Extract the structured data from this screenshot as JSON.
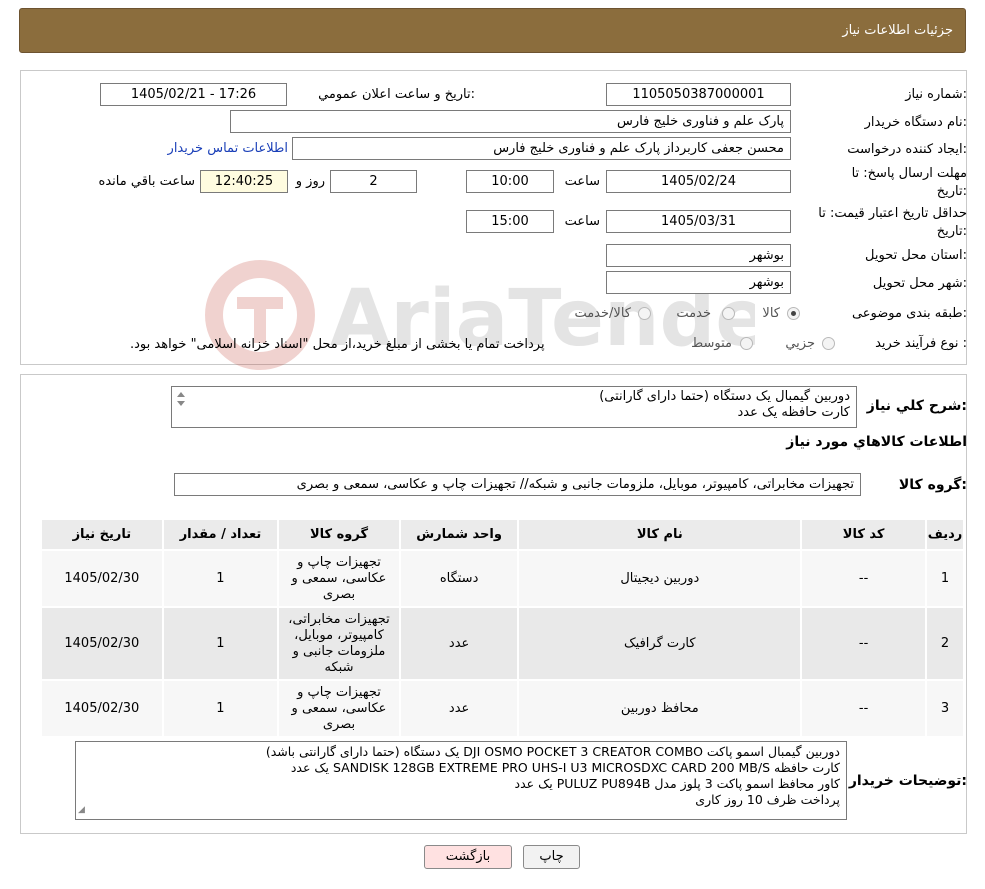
{
  "header": {
    "title": "جزئيات اطلاعات نياز"
  },
  "form": {
    "need_number_label": "شماره نياز:",
    "need_number": "1105050387000001",
    "announce_label": "تاريخ و ساعت اعلان عمومي:",
    "announce_value": "1405/02/21 - 17:26",
    "buyer_org_label": "نام دستگاه خريدار:",
    "buyer_org": "پارک علم و فناوری خلیج فارس",
    "creator_label": "ايجاد کننده درخواست:",
    "creator": "محسن جعفی کاربرداز پارک علم و فناوری خلیج فارس",
    "contact_link": "اطلاعات تماس خريدار",
    "deadline_label_1": "مهلت ارسال پاسخ: تا",
    "deadline_label_2": "تاريخ:",
    "deadline_date": "1405/02/24",
    "time_label": "ساعت",
    "deadline_time": "10:00",
    "days_value": "2",
    "days_label": "روز و",
    "remaining_time": "12:40:25",
    "remaining_label": "ساعت باقي مانده",
    "validity_label_1": "حداقل تاريخ اعتبار قيمت: تا",
    "validity_label_2": "تاريخ:",
    "validity_date": "1405/03/31",
    "validity_time": "15:00",
    "province_label": "استان محل تحويل:",
    "province": "بوشهر",
    "city_label": "شهر محل تحويل:",
    "city": "بوشهر",
    "category_label": "طبقه بندی موضوعی:",
    "category_options": [
      "کالا",
      "خدمت",
      "کالا/خدمت"
    ],
    "process_label": "نوع فرآيند خريد :",
    "process_options": [
      "جزيي",
      "متوسط"
    ],
    "payment_note": "پرداخت تمام يا بخشی از مبلغ خريد،از محل \"اسناد خزانه اسلامی\" خواهد بود."
  },
  "summary": {
    "label": "شرح کلي نياز:",
    "lines": [
      "دوربین گیمبال یک دستگاه (حتما دارای گارانتی)",
      "کارت حافظه  یک عدد"
    ]
  },
  "goods_section_title": "اطلاعات کالاهاي مورد نياز",
  "goods_group": {
    "label": "گروه کالا:",
    "value": "تجهیزات مخابراتی، کامپیوتر، موبایل، ملزومات جانبی و شبکه// تجهیزات چاپ و عکاسی، سمعی و بصری"
  },
  "table": {
    "headers": [
      "رديف",
      "کد کالا",
      "نام کالا",
      "واحد شمارش",
      "گروه کالا",
      "تعداد / مقدار",
      "تاريخ نياز"
    ],
    "rows": [
      {
        "row": "1",
        "code": "--",
        "name": "دوربین دیجیتال",
        "unit": "دستگاه",
        "group_lines": [
          "تجهیزات چاپ و",
          "عکاسی، سمعی و",
          "بصری"
        ],
        "qty": "1",
        "date": "1405/02/30"
      },
      {
        "row": "2",
        "code": "--",
        "name": "کارت گرافیک",
        "unit": "عدد",
        "group_lines": [
          "تجهیزات مخابراتی،",
          "کامپیوتر، موبایل،",
          "ملزومات جانبی و",
          "شبکه"
        ],
        "qty": "1",
        "date": "1405/02/30"
      },
      {
        "row": "3",
        "code": "--",
        "name": "محافظ دوربین",
        "unit": "عدد",
        "group_lines": [
          "تجهیزات چاپ و",
          "عکاسی، سمعی و",
          "بصری"
        ],
        "qty": "1",
        "date": "1405/02/30"
      }
    ]
  },
  "buyer_notes": {
    "label": "توضيحات خريدار:",
    "lines": [
      "دوربین گیمبال اسمو پاکت DJI OSMO POCKET 3 CREATOR COMBO یک دستگاه (حتما دارای گارانتی باشد)",
      "کارت حافظه SANDISK 128GB EXTREME PRO UHS-I U3 MICROSDXC CARD 200 MB/S یک عدد",
      "کاور محافظ اسمو پاکت 3 پلوز مدل PULUZ PU894B یک عدد",
      "پرداخت ظرف 10 روز کاری"
    ]
  },
  "buttons": {
    "print": "چاپ",
    "back": "بازگشت"
  },
  "watermark_text": "AriaTender.neT",
  "colors": {
    "header_bg": "#8b6d3d",
    "link": "#1a3fb8",
    "back_button_bg": "#ffe1e1",
    "remaining_bg": "#fffce0"
  }
}
